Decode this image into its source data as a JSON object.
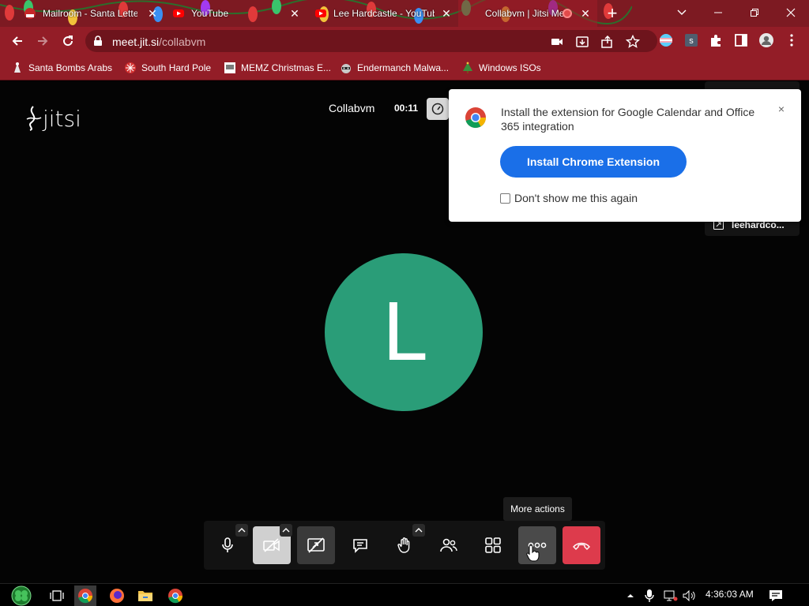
{
  "browser": {
    "tabs": [
      {
        "title": "Mailroom - Santa Letters",
        "favicon": "santa-icon"
      },
      {
        "title": "YouTube",
        "favicon": "youtube-icon"
      },
      {
        "title": "Lee Hardcastle - YouTube",
        "favicon": "youtube-icon"
      },
      {
        "title": "Collabvm | Jitsi Meet",
        "favicon": "jitsi-icon",
        "active": true
      }
    ],
    "url_host": "meet.jit.si",
    "url_path": "/collabvm",
    "bookmarks": [
      {
        "label": "Santa Bombs Arabs",
        "icon": "santa-icon"
      },
      {
        "label": "South Hard Pole",
        "icon": "snowflake-icon"
      },
      {
        "label": "MEMZ Christmas E...",
        "icon": "memz-icon"
      },
      {
        "label": "Endermanch Malwa...",
        "icon": "raccoon-icon"
      },
      {
        "label": "Windows ISOs",
        "icon": "tree-icon"
      }
    ],
    "theme_color": "#931d27"
  },
  "jitsi": {
    "logo_text": "jitsi",
    "meeting_title": "Collabvm",
    "timer": "00:11",
    "avatar_letter": "L",
    "avatar_color": "#2a9d78",
    "screenshare_user": "leehardco...",
    "popup": {
      "message": "Install the extension for Google Calendar and Office 365 integration",
      "install_label": "Install Chrome Extension",
      "dont_show_label": "Don't show me this again",
      "close_label": "×"
    },
    "tooltip": "More actions",
    "toolbar_buttons": [
      "microphone",
      "camera",
      "screenshare",
      "chat",
      "raise-hand",
      "participants",
      "tile-view",
      "more-actions",
      "hangup"
    ]
  },
  "taskbar": {
    "clock": "4:36:03 AM"
  }
}
